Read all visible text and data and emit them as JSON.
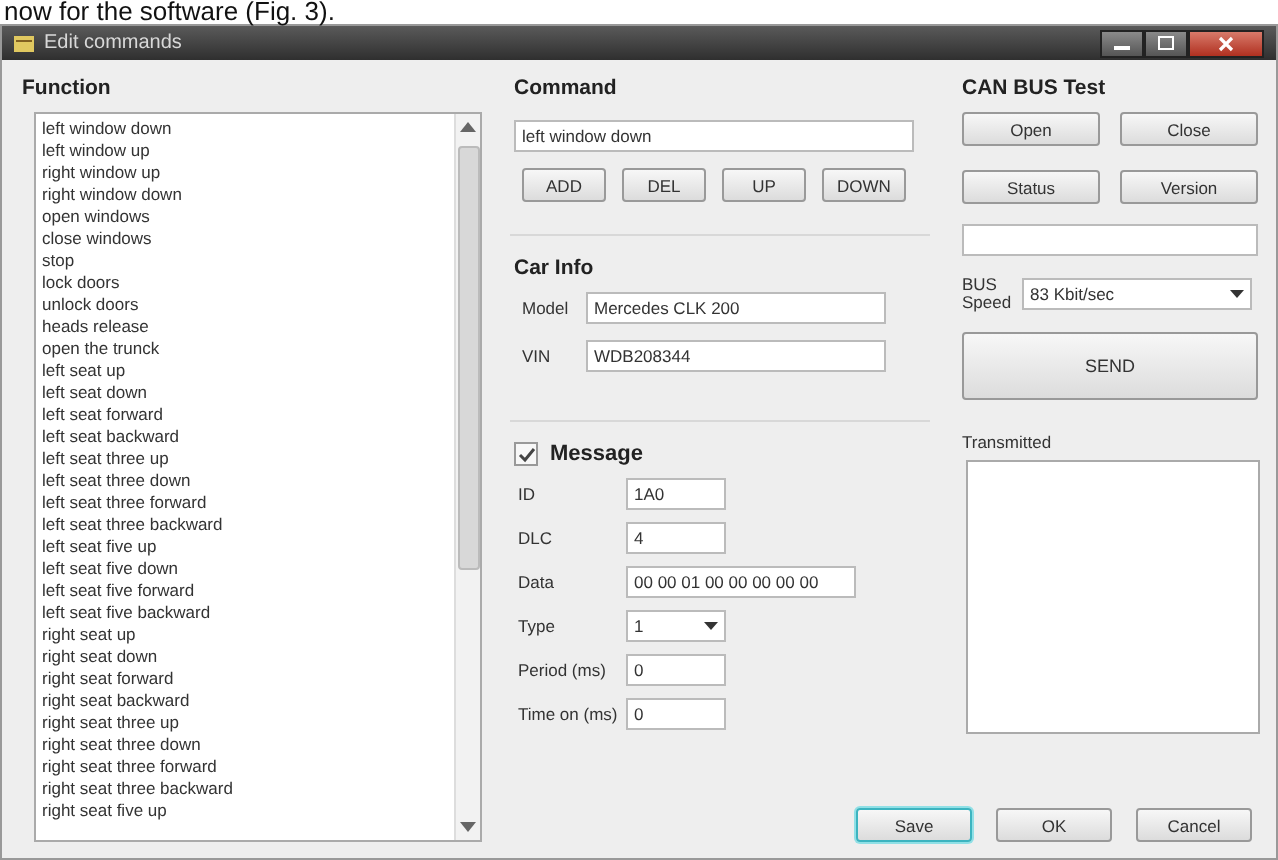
{
  "caption": "now for the software (Fig. 3).",
  "window": {
    "title": "Edit commands"
  },
  "function_group": {
    "title": "Function",
    "items": [
      "left window down",
      "left window up",
      "right window up",
      "right window down",
      "open windows",
      "close windows",
      "stop",
      "lock doors",
      "unlock doors",
      "heads release",
      "open the trunck",
      "left seat up",
      "left seat down",
      "left seat forward",
      "left seat backward",
      "left seat three up",
      "left seat three down",
      "left seat three forward",
      "left seat three backward",
      "left seat five up",
      "left seat five down",
      "left seat five forward",
      "left seat five backward",
      "right seat up",
      "right seat down",
      "right seat forward",
      "right seat backward",
      "right seat three up",
      "right seat three down",
      "right seat three forward",
      "right seat three backward",
      "right seat five up"
    ]
  },
  "command_group": {
    "title": "Command",
    "value": "left window down",
    "buttons": [
      "ADD",
      "DEL",
      "UP",
      "DOWN"
    ]
  },
  "car_info": {
    "title": "Car Info",
    "fields": [
      {
        "label": "Model",
        "value": "Mercedes CLK 200"
      },
      {
        "label": "VIN",
        "value": "WDB208344"
      }
    ]
  },
  "message": {
    "title": "Message",
    "checked": true,
    "fields": [
      {
        "label": "ID",
        "value": "1A0",
        "kind": "short"
      },
      {
        "label": "DLC",
        "value": "4",
        "kind": "short"
      },
      {
        "label": "Data",
        "value": "00 00 01 00 00 00 00 00",
        "kind": "long"
      },
      {
        "label": "Type",
        "value": "1",
        "kind": "select"
      },
      {
        "label": "Period (ms)",
        "value": "0",
        "kind": "short"
      },
      {
        "label": "Time on (ms)",
        "value": "0",
        "kind": "short"
      }
    ]
  },
  "can_bus": {
    "title": "CAN BUS Test",
    "buttons": [
      "Open",
      "Close",
      "Status",
      "Version"
    ],
    "speed_label": "BUS Speed",
    "speed_value": "83 Kbit/sec",
    "send": "SEND",
    "transmitted_label": "Transmitted"
  },
  "footer_buttons": [
    {
      "label": "Save",
      "focused": true
    },
    {
      "label": "OK",
      "focused": false
    },
    {
      "label": "Cancel",
      "focused": false
    }
  ]
}
